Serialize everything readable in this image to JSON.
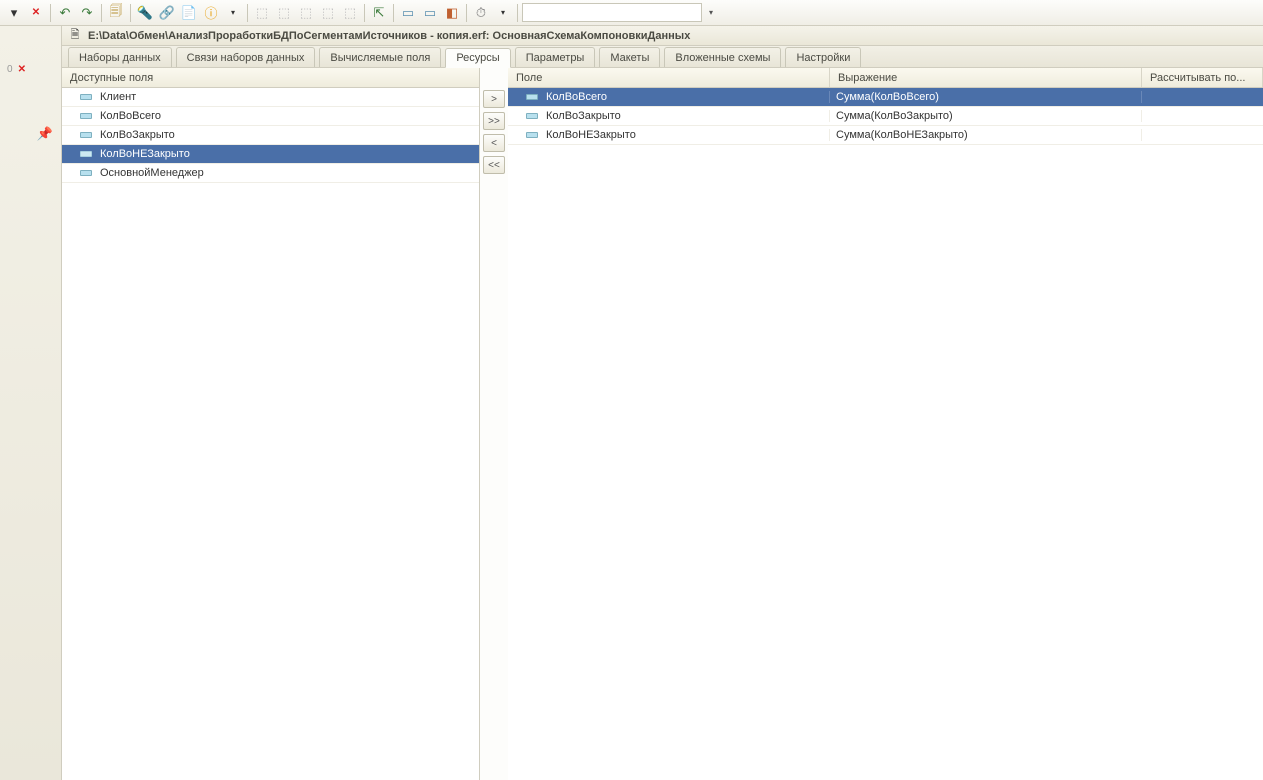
{
  "toolbar": {
    "dropdown_value": ""
  },
  "sidebar": {
    "pinned_label": ""
  },
  "window": {
    "title": "E:\\Data\\Обмен\\АнализПроработкиБДПоСегментамИсточников - копия.erf: ОсновнаяСхемаКомпоновкиДанных"
  },
  "tabs": [
    {
      "label": "Наборы данных",
      "active": false
    },
    {
      "label": "Связи наборов данных",
      "active": false
    },
    {
      "label": "Вычисляемые поля",
      "active": false
    },
    {
      "label": "Ресурсы",
      "active": true
    },
    {
      "label": "Параметры",
      "active": false
    },
    {
      "label": "Макеты",
      "active": false
    },
    {
      "label": "Вложенные схемы",
      "active": false
    },
    {
      "label": "Настройки",
      "active": false
    }
  ],
  "left_panel": {
    "header": "Доступные поля",
    "fields": [
      {
        "name": "Клиент",
        "selected": false
      },
      {
        "name": "КолВоВсего",
        "selected": false
      },
      {
        "name": "КолВоЗакрыто",
        "selected": false
      },
      {
        "name": "КолВоНЕЗакрыто",
        "selected": true
      },
      {
        "name": "ОсновнойМенеджер",
        "selected": false
      }
    ]
  },
  "move_buttons": {
    "add": ">",
    "add_all": ">>",
    "remove": "<",
    "remove_all": "<<"
  },
  "right_panel": {
    "columns": {
      "field": "Поле",
      "expression": "Выражение",
      "calculate_by": "Рассчитывать по..."
    },
    "rows": [
      {
        "field": "КолВоВсего",
        "expression": "Сумма(КолВоВсего)",
        "calc": "",
        "selected": true
      },
      {
        "field": "КолВоЗакрыто",
        "expression": "Сумма(КолВоЗакрыто)",
        "calc": "",
        "selected": false
      },
      {
        "field": "КолВоНЕЗакрыто",
        "expression": "Сумма(КолВоНЕЗакрыто)",
        "calc": "",
        "selected": false
      }
    ]
  }
}
